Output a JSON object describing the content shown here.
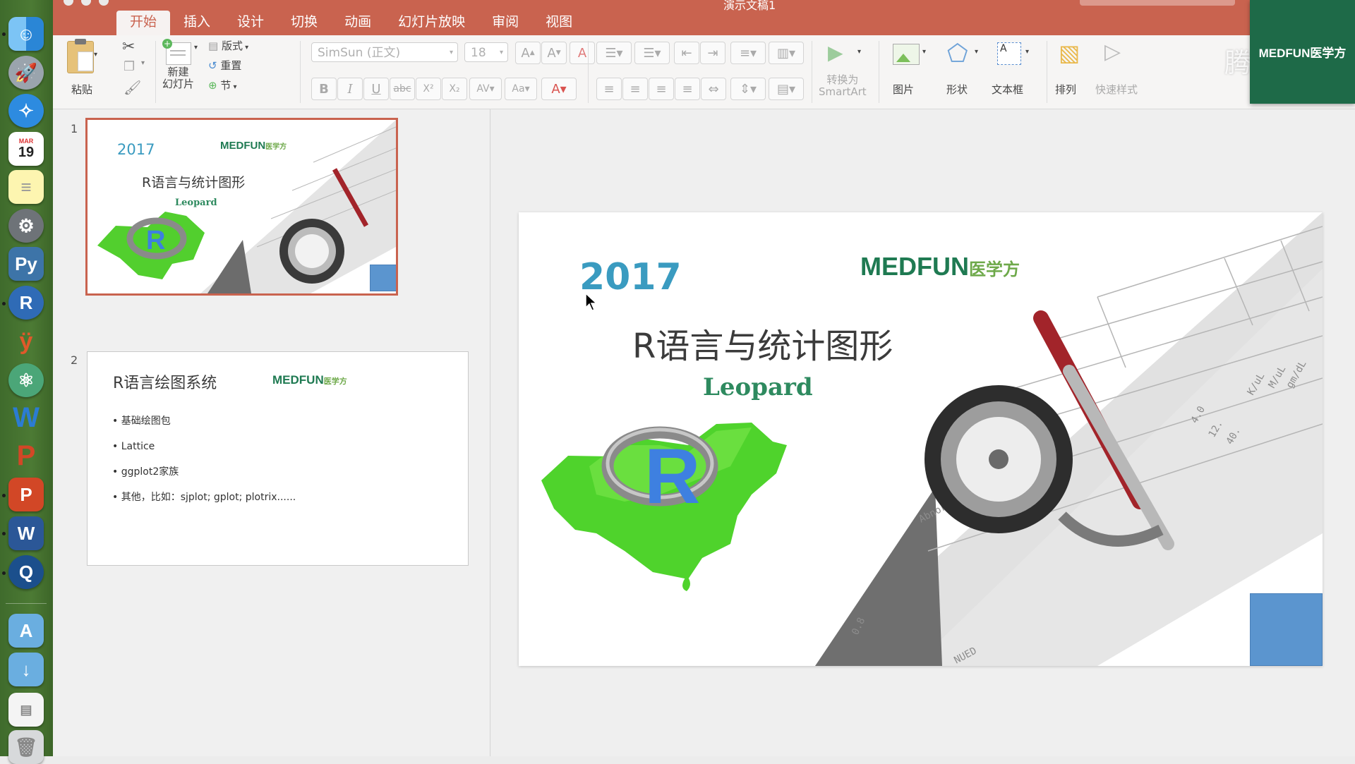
{
  "window": {
    "doc_title": "演示文稿1"
  },
  "tabs": [
    {
      "label": "开始",
      "active": true
    },
    {
      "label": "插入"
    },
    {
      "label": "设计"
    },
    {
      "label": "切换"
    },
    {
      "label": "动画"
    },
    {
      "label": "幻灯片放映"
    },
    {
      "label": "审阅"
    },
    {
      "label": "视图"
    }
  ],
  "ribbon": {
    "paste": "粘贴",
    "new_slide_line1": "新建",
    "new_slide_line2": "幻灯片",
    "layout": "版式",
    "reset": "重置",
    "section": "节",
    "font_name": "SimSun (正文)",
    "font_size": "18",
    "convert_line1": "转换为",
    "convert_line2": "SmartArt",
    "picture": "图片",
    "shape": "形状",
    "textbox": "文本框",
    "arrange": "排列",
    "quick_styles": "快速样式",
    "format_buttons": [
      "B",
      "I",
      "U",
      "abc",
      "X²",
      "X₂"
    ]
  },
  "watermark": "腾讯课堂",
  "brand_logo": "MEDFUN医学方",
  "thumbnails": [
    {
      "number": "1",
      "year": "2017",
      "title": "R语言与统计图形",
      "subtitle": "Leopard",
      "logo": "MEDFUN",
      "logo_cn": "医学方"
    },
    {
      "number": "2",
      "title": "R语言绘图系统",
      "logo": "MEDFUN",
      "logo_cn": "医学方",
      "bullets": [
        "• 基础绘图包",
        "• Lattice",
        "• ggplot2家族",
        "• 其他，比如：sjplot; gplot; plotrix......"
      ]
    }
  ],
  "main_slide": {
    "year": "2017",
    "title": "R语言与统计图形",
    "subtitle": "Leopard",
    "logo": "MEDFUN",
    "logo_cn": "医学方",
    "r_letter": "R"
  },
  "dock": {
    "calendar_month": "MAR",
    "calendar_day": "19"
  },
  "colors": {
    "accent": "#c9634f",
    "brand_green": "#1f7a52",
    "year_blue": "#3a9bc0",
    "square_blue": "#5b95cf"
  }
}
